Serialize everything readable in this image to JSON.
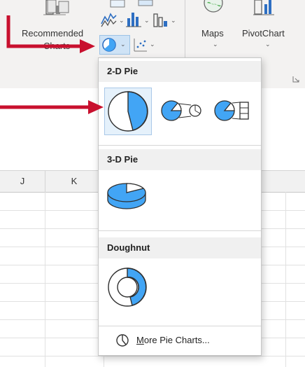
{
  "ribbon": {
    "recommended_label_line1": "Recommended",
    "recommended_label_line2": "Charts",
    "maps_label": "Maps",
    "pivotchart_label": "PivotChart"
  },
  "dropdown": {
    "sections": [
      {
        "title": "2-D Pie"
      },
      {
        "title": "3-D Pie"
      },
      {
        "title": "Doughnut"
      }
    ],
    "more_link_first_letter": "M",
    "more_link_rest": "ore Pie Charts..."
  },
  "sheet": {
    "columns": [
      "J",
      "K"
    ]
  },
  "colors": {
    "accent": "#42a5f5",
    "annotation": "#c8102e",
    "selection": "#e5f1fb"
  }
}
